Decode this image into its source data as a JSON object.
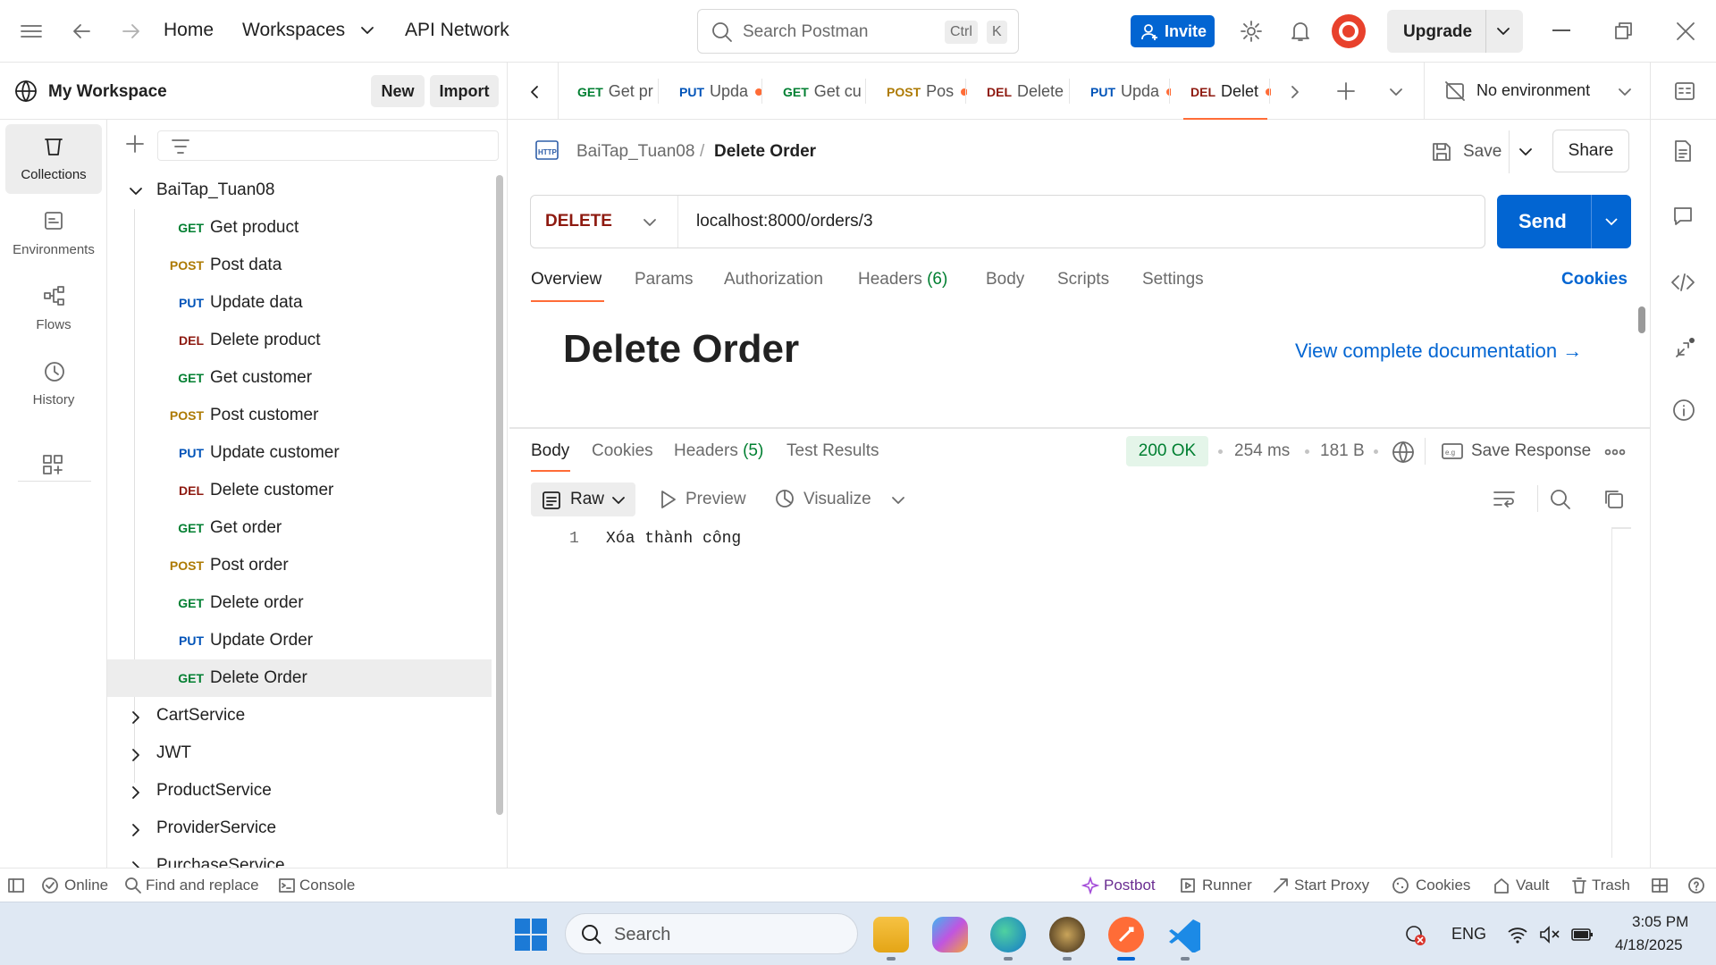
{
  "topbar": {
    "home": "Home",
    "workspaces": "Workspaces",
    "api_network": "API Network",
    "search_placeholder": "Search Postman",
    "kbd_ctrl": "Ctrl",
    "kbd_k": "K",
    "invite": "Invite",
    "upgrade": "Upgrade"
  },
  "workspace": {
    "name": "My Workspace",
    "new_label": "New",
    "import_label": "Import"
  },
  "rail": [
    {
      "label": "Collections",
      "icon": "trash-can-icon"
    },
    {
      "label": "Environments",
      "icon": "environment-icon"
    },
    {
      "label": "Flows",
      "icon": "flows-icon"
    },
    {
      "label": "History",
      "icon": "history-icon"
    }
  ],
  "collection": {
    "name": "BaiTap_Tuan08",
    "requests": [
      {
        "method": "GET",
        "name": "Get product"
      },
      {
        "method": "POST",
        "name": "Post data"
      },
      {
        "method": "PUT",
        "name": "Update data"
      },
      {
        "method": "DEL",
        "name": "Delete product"
      },
      {
        "method": "GET",
        "name": "Get customer"
      },
      {
        "method": "POST",
        "name": "Post customer"
      },
      {
        "method": "PUT",
        "name": "Update customer"
      },
      {
        "method": "DEL",
        "name": "Delete customer"
      },
      {
        "method": "GET",
        "name": "Get order"
      },
      {
        "method": "POST",
        "name": "Post order"
      },
      {
        "method": "GET",
        "name": "Delete order"
      },
      {
        "method": "PUT",
        "name": "Update Order"
      },
      {
        "method": "GET",
        "name": "Delete Order"
      }
    ]
  },
  "other_collections": [
    "CartService",
    "JWT",
    "ProductService",
    "ProviderService",
    "PurchaseService"
  ],
  "tabs": [
    {
      "method": "GET",
      "label": "Get pr",
      "dot": false
    },
    {
      "method": "PUT",
      "label": "Upda",
      "dot": true
    },
    {
      "method": "GET",
      "label": "Get cu",
      "dot": false
    },
    {
      "method": "POST",
      "label": "Pos",
      "dot": true
    },
    {
      "method": "DEL",
      "label": "Delete",
      "dot": false
    },
    {
      "method": "PUT",
      "label": "Upda",
      "dot": true
    },
    {
      "method": "DEL",
      "label": "Delet",
      "dot": true
    }
  ],
  "environment": "No environment",
  "request": {
    "breadcrumb_collection": "BaiTap_Tuan08",
    "breadcrumb_sep": "/",
    "title": "Delete Order",
    "save_label": "Save",
    "share_label": "Share",
    "method": "DELETE",
    "url": "localhost:8000/orders/3",
    "send_label": "Send",
    "subtabs": [
      "Overview",
      "Params",
      "Authorization",
      "Headers",
      "Body",
      "Scripts",
      "Settings"
    ],
    "headers_count": "(6)",
    "cookies_link": "Cookies",
    "doc_title": "Delete Order",
    "doc_link": "View complete documentation →"
  },
  "response": {
    "tabs": [
      "Body",
      "Cookies",
      "Headers",
      "Test Results"
    ],
    "headers_count": "(5)",
    "status": "200 OK",
    "time": "254 ms",
    "size": "181 B",
    "save_response": "Save Response",
    "format": "Raw",
    "preview": "Preview",
    "visualize": "Visualize",
    "line_number": "1",
    "body_text": "Xóa thành công"
  },
  "statusbar": {
    "online": "Online",
    "find_replace": "Find and replace",
    "console": "Console",
    "postbot": "Postbot",
    "runner": "Runner",
    "start_proxy": "Start Proxy",
    "cookies": "Cookies",
    "vault": "Vault",
    "trash": "Trash"
  },
  "taskbar": {
    "search": "Search",
    "lang": "ENG",
    "time": "3:05 PM",
    "date": "4/18/2025"
  },
  "colors": {
    "accent": "#FF6C37",
    "primary": "#0265D2",
    "get": "#007F31",
    "post": "#AD7A03",
    "put": "#0053B8",
    "del": "#8E1A10",
    "ok": "#007F31"
  }
}
